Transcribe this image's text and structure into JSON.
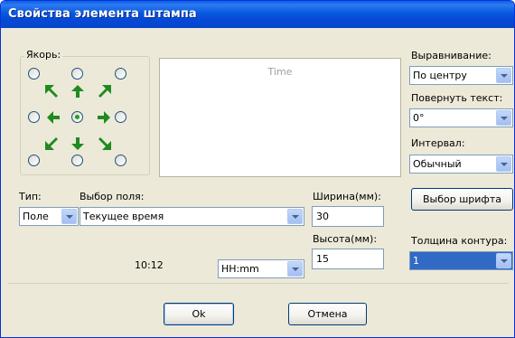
{
  "window": {
    "title": "Свойства элемента штампа"
  },
  "anchor": {
    "label": "Якорь:",
    "selected": "center"
  },
  "preview": {
    "text": "Time"
  },
  "alignment": {
    "label": "Выравнивание:",
    "value": "По центру"
  },
  "rotate": {
    "label": "Повернуть текст:",
    "value": "0°"
  },
  "spacing": {
    "label": "Интервал:",
    "value": "Обычный"
  },
  "type": {
    "label": "Тип:",
    "value": "Поле"
  },
  "field": {
    "label": "Выбор поля:",
    "value": "Текущее время"
  },
  "width": {
    "label": "Ширина(мм):",
    "value": "30"
  },
  "height": {
    "label": "Высота(мм):",
    "value": "15"
  },
  "font_button": {
    "label": "Выбор шрифта"
  },
  "outline": {
    "label": "Толщина контура:",
    "value": "1"
  },
  "time_preview": {
    "value": "10:12"
  },
  "time_format": {
    "value": "HH:mm"
  },
  "buttons": {
    "ok": "Ok",
    "cancel": "Отмена"
  }
}
